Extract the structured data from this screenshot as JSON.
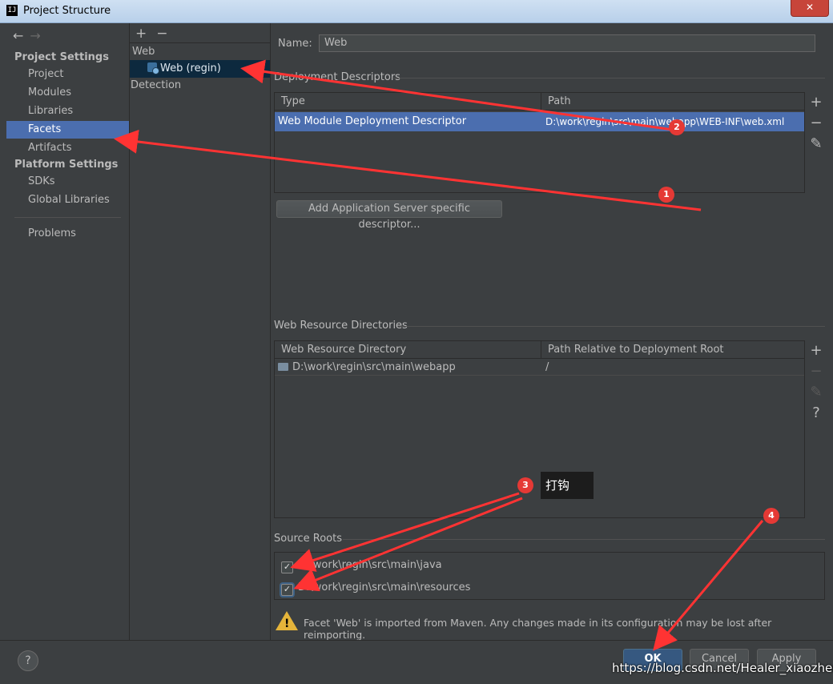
{
  "window": {
    "title": "Project Structure",
    "app_icon": "IJ",
    "close_symbol": "✕"
  },
  "sidebar": {
    "back_symbol": "←",
    "forward_symbol": "→",
    "project_settings_header": "Project Settings",
    "project_items": [
      "Project",
      "Modules",
      "Libraries",
      "Facets",
      "Artifacts"
    ],
    "platform_settings_header": "Platform Settings",
    "platform_items": [
      "SDKs",
      "Global Libraries"
    ],
    "problems": "Problems",
    "selected": "Facets"
  },
  "facets_tree": {
    "add_symbol": "+",
    "remove_symbol": "−",
    "group": "Web",
    "facet": "Web (regin)",
    "detection": "Detection"
  },
  "main": {
    "name_label": "Name:",
    "name_value": "Web",
    "deployment": {
      "section_title": "Deployment Descriptors",
      "columns": [
        "Type",
        "Path"
      ],
      "rows": [
        {
          "type": "Web Module Deployment Descriptor",
          "path": "D:\\work\\regin\\src\\main\\webapp\\WEB-INF\\web.xml"
        }
      ],
      "add_server_button": "Add Application Server specific descriptor..."
    },
    "web_resources": {
      "section_title": "Web Resource Directories",
      "columns": [
        "Web Resource Directory",
        "Path Relative to Deployment Root"
      ],
      "rows": [
        {
          "directory": "D:\\work\\regin\\src\\main\\webapp",
          "relative": "/"
        }
      ]
    },
    "source_roots": {
      "section_title": "Source Roots",
      "items": [
        {
          "path": "D:\\work\\regin\\src\\main\\java",
          "checked": true
        },
        {
          "path": "D:\\work\\regin\\src\\main\\resources",
          "checked": true
        }
      ]
    },
    "warning": "Facet 'Web' is imported from Maven. Any changes made in its configuration may be lost after reimporting."
  },
  "tool_symbols": {
    "add": "+",
    "remove": "−",
    "edit": "✎",
    "help": "?",
    "check": "✓"
  },
  "bottom": {
    "help": "?",
    "ok": "OK",
    "cancel": "Cancel",
    "apply": "Apply"
  },
  "annotations": {
    "tooltip": "打钩",
    "badges": [
      "1",
      "2",
      "3",
      "4"
    ],
    "arrow_color": "#ff3333"
  },
  "watermark": "https://blog.csdn.net/Healer_xiaozhen",
  "colors": {
    "selection": "#4b6eaf",
    "panel": "#3c3f41",
    "ok_button": "#365880"
  }
}
